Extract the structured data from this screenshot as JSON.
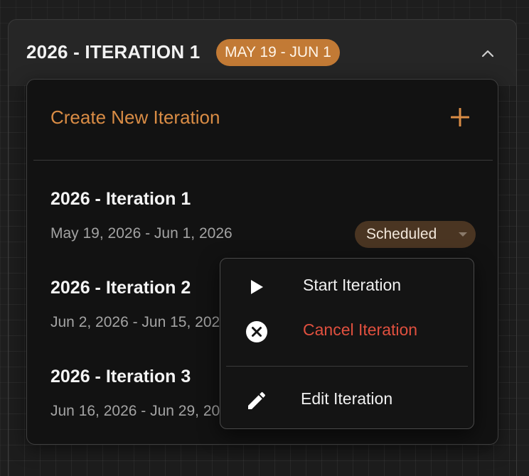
{
  "header": {
    "title": "2026 - ITERATION 1",
    "date_badge": "MAY 19 - JUN 1",
    "collapse_icon": "chevron-up-icon"
  },
  "dropdown": {
    "create_label": "Create New Iteration",
    "create_icon": "plus-icon",
    "iterations": [
      {
        "name": "2026 - Iteration 1",
        "dates": "May 19, 2026 - Jun 1, 2026",
        "status": "Scheduled"
      },
      {
        "name": "2026 - Iteration 2",
        "dates": "Jun 2, 2026 - Jun 15, 2026"
      },
      {
        "name": "2026 - Iteration 3",
        "dates": "Jun 16, 2026 - Jun 29, 2026"
      }
    ]
  },
  "context_menu": {
    "items": [
      {
        "label": "Start Iteration",
        "icon": "play-icon"
      },
      {
        "label": "Cancel Iteration",
        "icon": "cancel-circle-icon"
      },
      {
        "label": "Edit Iteration",
        "icon": "pencil-icon"
      }
    ]
  },
  "colors": {
    "accent": "#d98c45",
    "badge": "#c27a35",
    "danger": "#e0503f",
    "status_pill": "#4a3522"
  }
}
